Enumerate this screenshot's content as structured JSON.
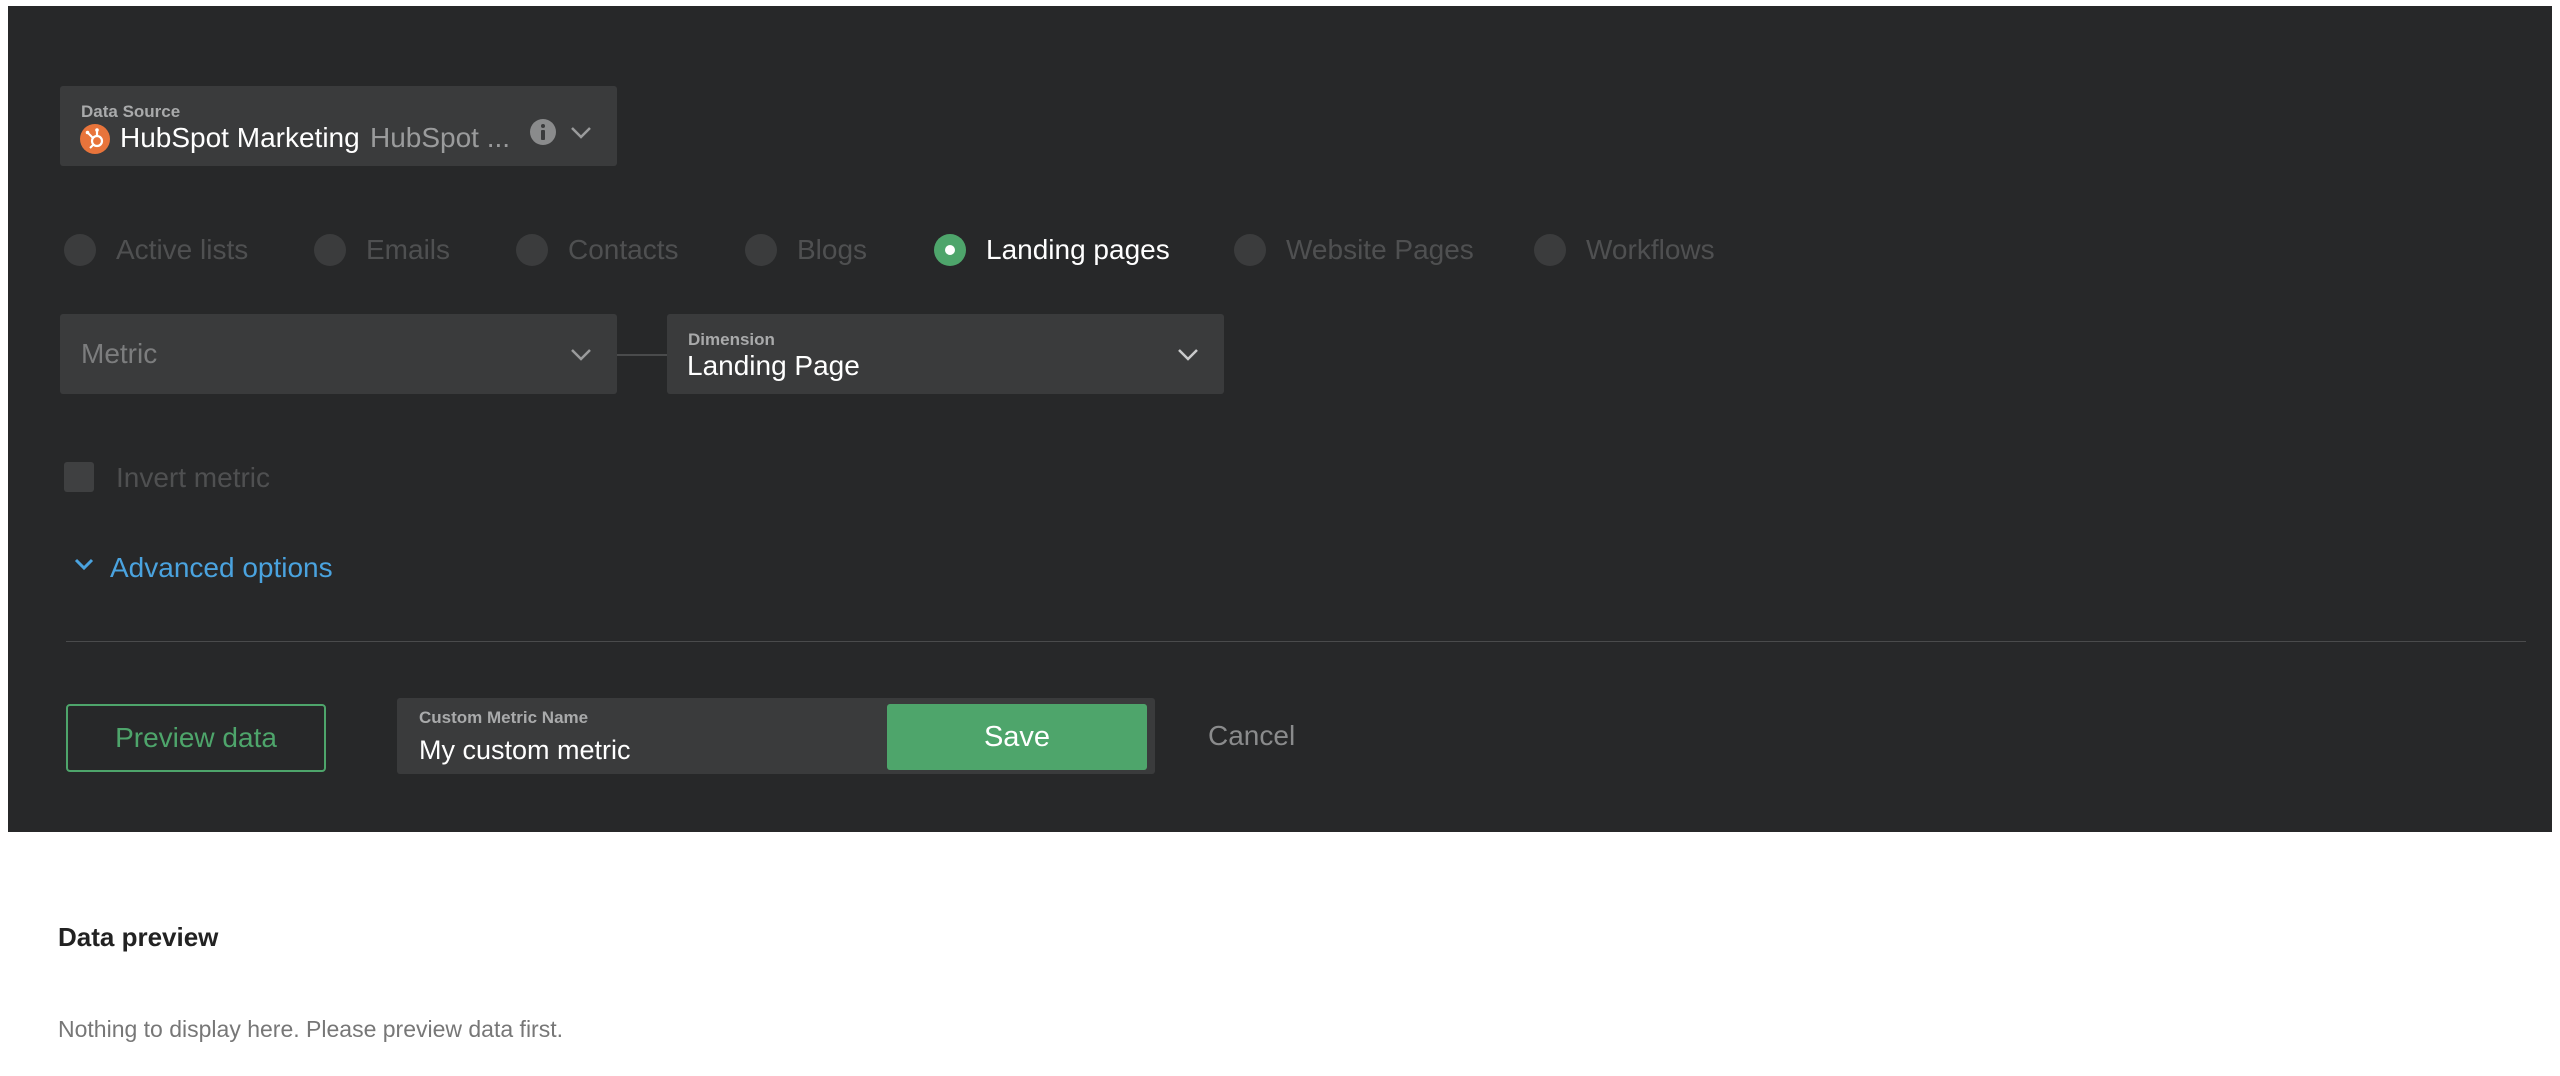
{
  "data_source": {
    "label": "Data Source",
    "name": "HubSpot Marketing",
    "sub": "HubSpot ...",
    "icon": "hubspot-icon"
  },
  "radios": [
    {
      "label": "Active lists",
      "selected": false
    },
    {
      "label": "Emails",
      "selected": false
    },
    {
      "label": "Contacts",
      "selected": false
    },
    {
      "label": "Blogs",
      "selected": false
    },
    {
      "label": "Landing pages",
      "selected": true
    },
    {
      "label": "Website Pages",
      "selected": false
    },
    {
      "label": "Workflows",
      "selected": false
    }
  ],
  "metric": {
    "placeholder": "Metric"
  },
  "dimension": {
    "label": "Dimension",
    "value": "Landing Page"
  },
  "invert": {
    "label": "Invert metric",
    "checked": false
  },
  "advanced": {
    "label": "Advanced options"
  },
  "actions": {
    "preview_label": "Preview data",
    "name_label": "Custom Metric Name",
    "name_value": "My custom metric",
    "save_label": "Save",
    "cancel_label": "Cancel"
  },
  "preview": {
    "title": "Data preview",
    "empty": "Nothing to display here. Please preview data first."
  },
  "colors": {
    "panel": "#272829",
    "accent_green": "#4ea56b",
    "link_blue": "#4aa3df",
    "hubspot_orange": "#e8743b"
  }
}
